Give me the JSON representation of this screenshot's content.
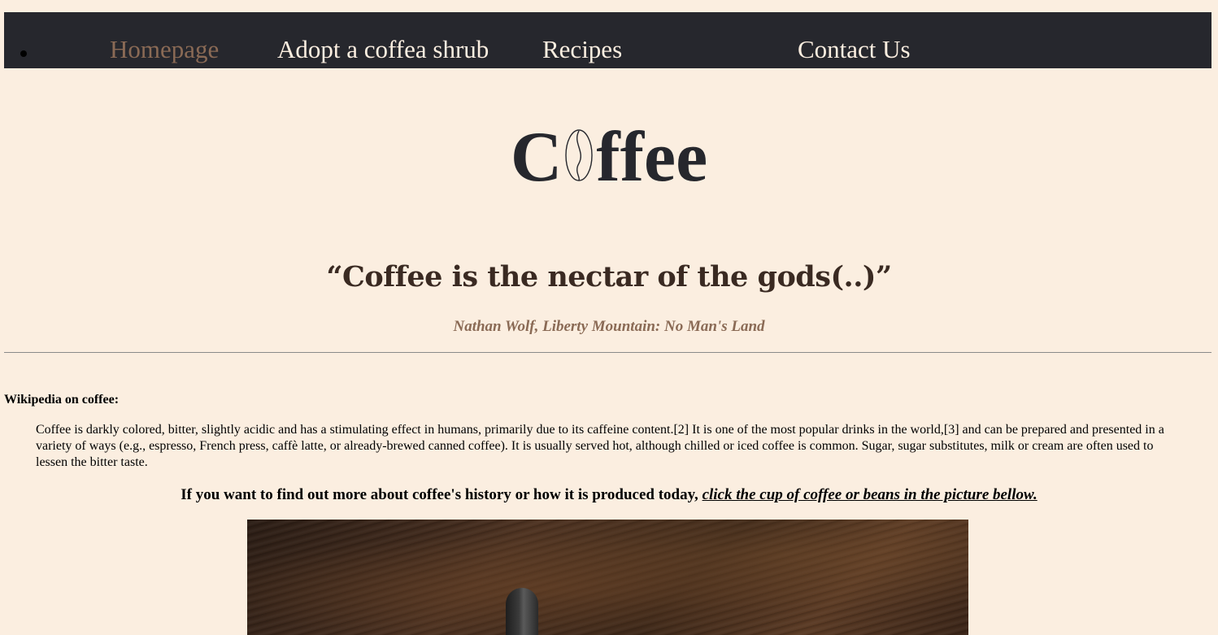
{
  "nav": {
    "items": [
      {
        "label": "Homepage",
        "active": true
      },
      {
        "label": "Adopt a coffea shrub",
        "active": false
      },
      {
        "label": "Recipes",
        "active": false
      },
      {
        "label": "Contact Us",
        "active": false
      }
    ]
  },
  "logo": {
    "prefix": "C",
    "suffix": "ffee",
    "icon": "coffee-bean-icon"
  },
  "quote": {
    "text": "“Coffee is the nectar of the gods(..)”",
    "attribution": "Nathan Wolf, Liberty Mountain: No Man's Land"
  },
  "wikipedia": {
    "heading": "Wikipedia on coffee:",
    "text": "Coffee is darkly colored, bitter, slightly acidic and has a stimulating effect in humans, primarily due to its caffeine content.[2] It is one of the most popular drinks in the world,[3] and can be prepared and presented in a variety of ways (e.g., espresso, French press, caffè latte, or already-brewed canned coffee). It is usually served hot, although chilled or iced coffee is common. Sugar, sugar substitutes, milk or cream are often used to lessen the bitter taste."
  },
  "more_info": {
    "text": "If you want to find out more about coffee's history or how it is produced today, ",
    "link": "click the cup of coffee or beans in the picture bellow."
  },
  "colors": {
    "background": "#fbeee0",
    "nav_background": "#26272d",
    "accent": "#8a6a55",
    "heading": "#26272d"
  }
}
